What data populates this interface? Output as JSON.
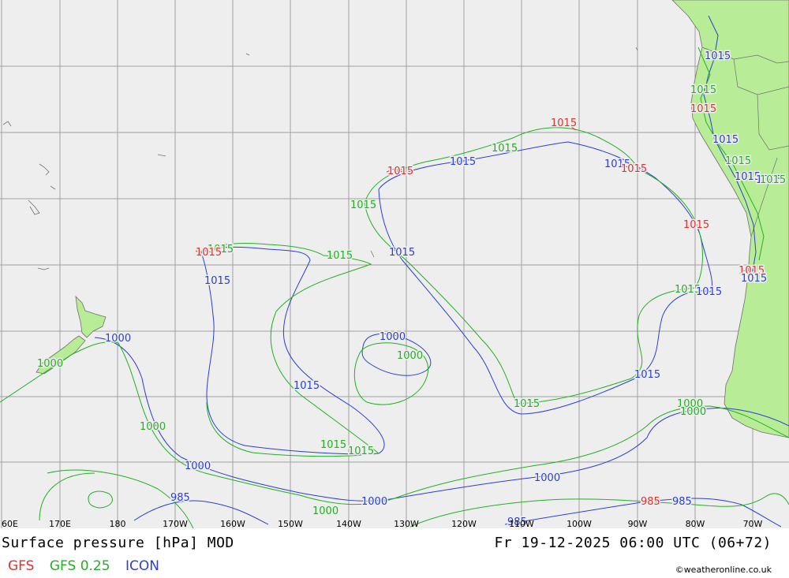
{
  "map": {
    "lon_labels": [
      "60E",
      "170E",
      "180",
      "170W",
      "160W",
      "150W",
      "140W",
      "130W",
      "120W",
      "110W",
      "100W",
      "90W",
      "80W",
      "70W"
    ],
    "colors": {
      "ocean": "#eeeeee",
      "land": "#b8ec96",
      "grid": "#a0a0a0",
      "gfs": "#e03030",
      "gfs025": "#22b022",
      "icon": "#2a3ed8"
    },
    "isobar_labels": [
      {
        "text": "1015",
        "model": "icon"
      },
      {
        "text": "1015",
        "model": "gfs025"
      },
      {
        "text": "1015",
        "model": "gfs"
      },
      {
        "text": "1015",
        "model": "icon"
      },
      {
        "text": "1015",
        "model": "gfs025"
      },
      {
        "text": "1015",
        "model": "icon"
      },
      {
        "text": "1015",
        "model": "icon"
      },
      {
        "text": "1015",
        "model": "gfs"
      },
      {
        "text": "1015",
        "model": "icon"
      },
      {
        "text": "1015",
        "model": "gfs025"
      },
      {
        "text": "1015",
        "model": "gfs"
      },
      {
        "text": "1015",
        "model": "icon"
      },
      {
        "text": "1015",
        "model": "gfs"
      },
      {
        "text": "1015",
        "model": "gfs025"
      },
      {
        "text": "1015",
        "model": "icon"
      },
      {
        "text": "1015",
        "model": "gfs"
      },
      {
        "text": "1015",
        "model": "gfs025"
      },
      {
        "text": "1015",
        "model": "gfs025"
      },
      {
        "text": "1015",
        "model": "icon"
      },
      {
        "text": "1015",
        "model": "gfs"
      },
      {
        "text": "1015",
        "model": "icon"
      },
      {
        "text": "1015",
        "model": "gfs"
      },
      {
        "text": "1015",
        "model": "gfs025"
      },
      {
        "text": "1015",
        "model": "icon"
      },
      {
        "text": "1015",
        "model": "gfs025"
      },
      {
        "text": "1015",
        "model": "icon"
      },
      {
        "text": "1015",
        "model": "gfs025"
      },
      {
        "text": "1015",
        "model": "icon"
      },
      {
        "text": "1015",
        "model": "gfs025"
      },
      {
        "text": "1015",
        "model": "icon"
      },
      {
        "text": "1015",
        "model": "gfs025"
      },
      {
        "text": "1000",
        "model": "icon"
      },
      {
        "text": "1000",
        "model": "gfs025"
      },
      {
        "text": "1000",
        "model": "gfs025"
      },
      {
        "text": "1000",
        "model": "icon"
      },
      {
        "text": "1000",
        "model": "gfs025"
      },
      {
        "text": "1000",
        "model": "icon"
      },
      {
        "text": "1000",
        "model": "gfs025"
      },
      {
        "text": "1000",
        "model": "icon"
      },
      {
        "text": "1000",
        "model": "gfs025"
      },
      {
        "text": "1000",
        "model": "icon"
      },
      {
        "text": "1000",
        "model": "gfs025"
      },
      {
        "text": "985",
        "model": "icon"
      },
      {
        "text": "985",
        "model": "icon"
      },
      {
        "text": "985",
        "model": "icon"
      },
      {
        "text": "985",
        "model": "gfs025"
      },
      {
        "text": "985",
        "model": "gfs"
      }
    ]
  },
  "footer": {
    "title": "Surface pressure [hPa] MOD",
    "datetime": "Fr 19-12-2025 06:00 UTC (06+72)",
    "models": [
      "GFS",
      "GFS 0.25",
      "ICON"
    ],
    "copyright": "©weatheronline.co.uk"
  }
}
